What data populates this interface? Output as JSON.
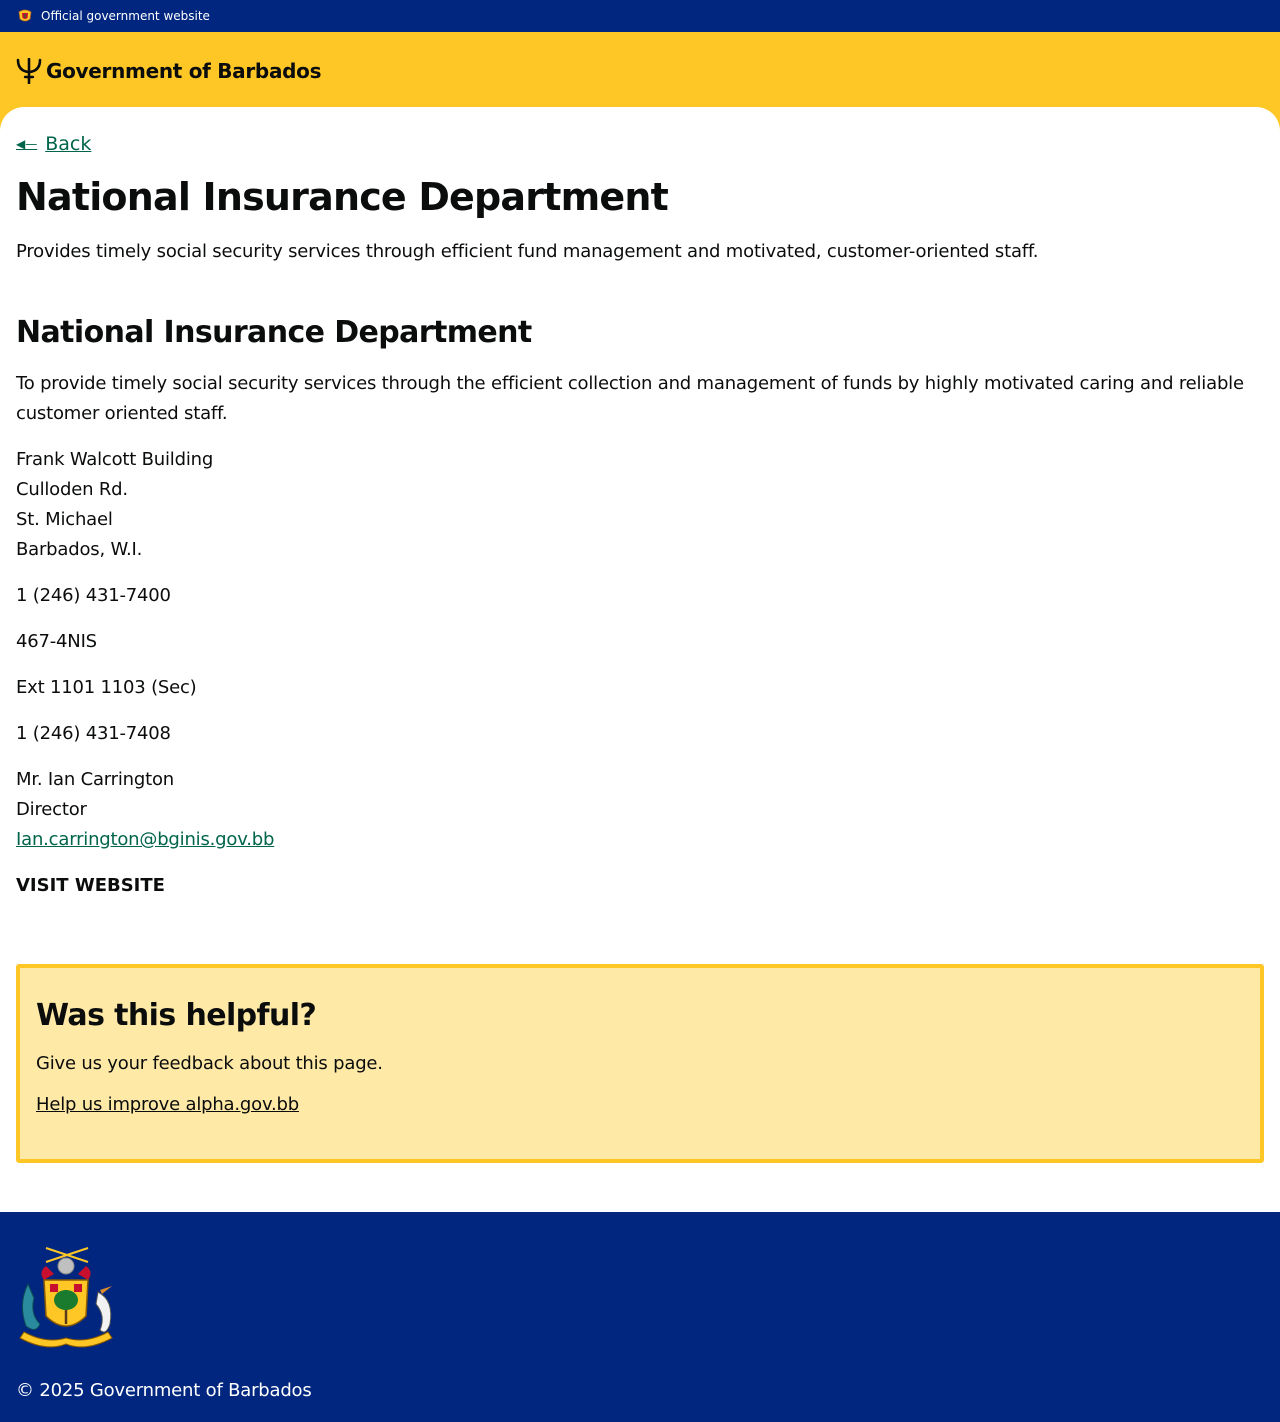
{
  "topbar": {
    "official_label": "Official government website",
    "crest_icon": "barbados-crest-icon"
  },
  "header": {
    "brand_label": "Government of Barbados",
    "logo_icon": "trident-icon",
    "background_color": "#ffc726"
  },
  "nav": {
    "back_label": "Back"
  },
  "page": {
    "title": "National Insurance Department",
    "lead": "Provides timely social security services through efficient fund management and motivated, customer-oriented staff."
  },
  "department": {
    "name": "National Insurance Department",
    "mission": "To provide timely social security services through the efficient collection and management of funds by highly motivated caring and reliable customer oriented staff.",
    "address": [
      "Frank Walcott Building",
      "Culloden Rd.",
      "St. Michael",
      "Barbados, W.I."
    ],
    "phone": "1 (246) 431-7400",
    "phone_alt": "467-4NIS",
    "extension": "Ext 1101 1103 (Sec)",
    "fax": "1 (246) 431-7408",
    "contact_name": "Mr. Ian Carrington",
    "contact_title": "Director",
    "contact_email": "Ian.carrington@bginis.gov.bb",
    "website_label": "VISIT WEBSITE"
  },
  "feedback": {
    "heading": "Was this helpful?",
    "text": "Give us your feedback about this page.",
    "link_label": "Help us improve alpha.gov.bb"
  },
  "footer": {
    "copyright": "© 2025 Government of Barbados",
    "coat_icon": "barbados-coat-of-arms-icon"
  },
  "colors": {
    "navy": "#00267f",
    "gold": "#ffc726",
    "link_green": "#00654a",
    "feedback_bg": "#fee9a6"
  }
}
